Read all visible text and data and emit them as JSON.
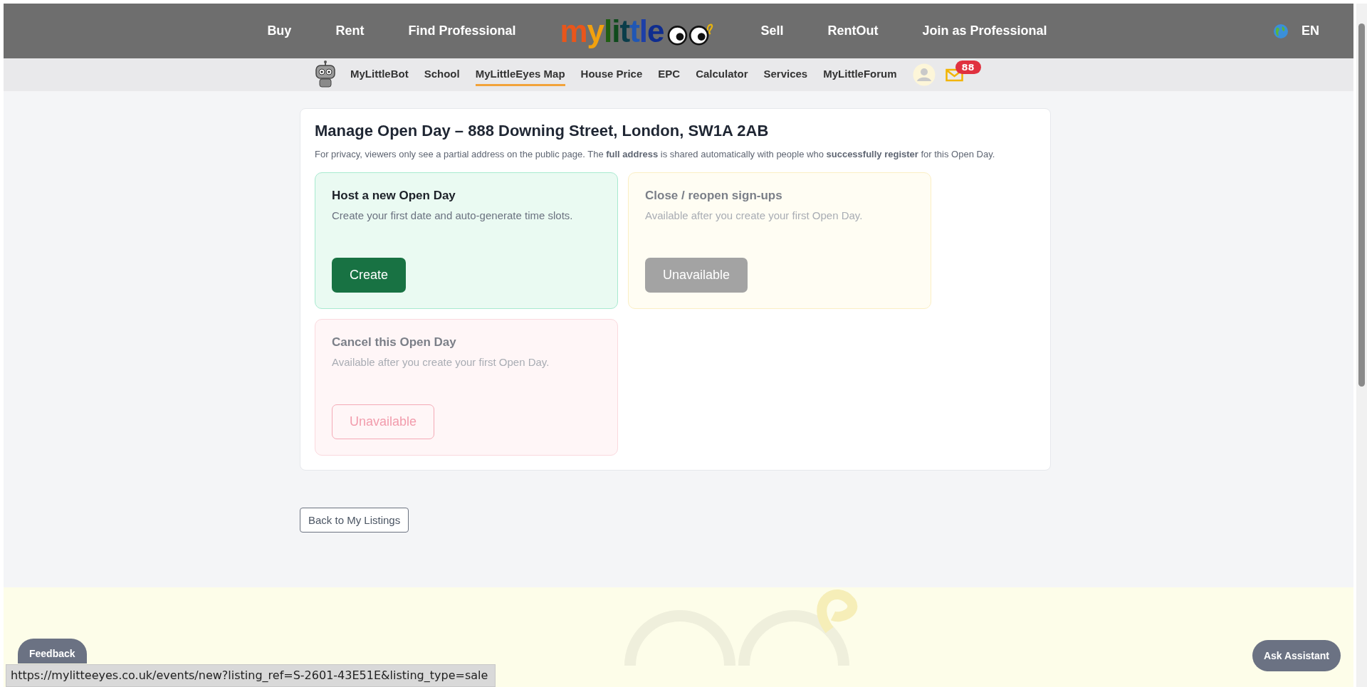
{
  "top_nav": {
    "left": [
      "Buy",
      "Rent",
      "Find Professional"
    ],
    "logo": "mylittle",
    "right": [
      "Sell",
      "RentOut",
      "Join as Professional"
    ],
    "language": "EN"
  },
  "sub_nav": {
    "items": [
      {
        "label": "MyLittleBot",
        "selected": false
      },
      {
        "label": "School",
        "selected": false
      },
      {
        "label": "MyLittleEyes Map",
        "selected": true
      },
      {
        "label": "House Price",
        "selected": false
      },
      {
        "label": "EPC",
        "selected": false
      },
      {
        "label": "Calculator",
        "selected": false
      },
      {
        "label": "Services",
        "selected": false
      },
      {
        "label": "MyLittleForum",
        "selected": false
      }
    ],
    "mail_badge": "88"
  },
  "panel": {
    "title": "Manage Open Day – 888 Downing Street, London, SW1A 2AB",
    "note": "For privacy, viewers only see a partial address on the public page. The **full address** is shared automatically with people who **successfully register** for this Open Day.",
    "cards": [
      {
        "kind": "create",
        "title": "Host a new Open Day",
        "text": "Create your first date and auto-generate time slots.",
        "button": "Create",
        "disabled": false
      },
      {
        "kind": "toggle",
        "title": "Close / reopen sign-ups",
        "text": "Available after you create your first Open Day.",
        "button": "Unavailable",
        "disabled": true
      },
      {
        "kind": "cancel",
        "title": "Cancel this Open Day",
        "text": "Available after you create your first Open Day.",
        "button": "Unavailable",
        "disabled": true
      }
    ]
  },
  "back_button": "Back to My Listings",
  "feedback_button": "Feedback",
  "assistant_button": "Ask Assistant",
  "status_url": "https://mylitteeyes.co.uk/events/new?listing_ref=S-2601-43E51E&listing_type=sale"
}
